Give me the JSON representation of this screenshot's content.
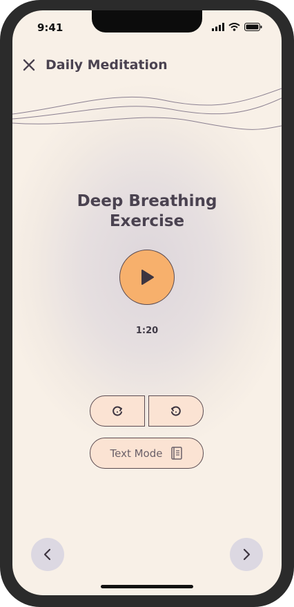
{
  "status_bar": {
    "time": "9:41"
  },
  "header": {
    "title": "Daily Meditation",
    "close_icon": "close-icon"
  },
  "session": {
    "title_line1": "Deep Breathing",
    "title_line2": "Exercise",
    "elapsed": "1:20"
  },
  "controls": {
    "play_icon": "play-icon",
    "rewind_icon": "rewind-icon",
    "replay_icon": "replay-icon",
    "text_mode_label": "Text Mode",
    "text_mode_icon": "book-icon"
  },
  "navigation": {
    "prev_icon": "chevron-left-icon",
    "next_icon": "chevron-right-icon"
  },
  "colors": {
    "accent": "#f7b06c",
    "button_fill": "#fbe3d3",
    "text": "#4a4250",
    "nav_bg": "#dcd8e2"
  }
}
